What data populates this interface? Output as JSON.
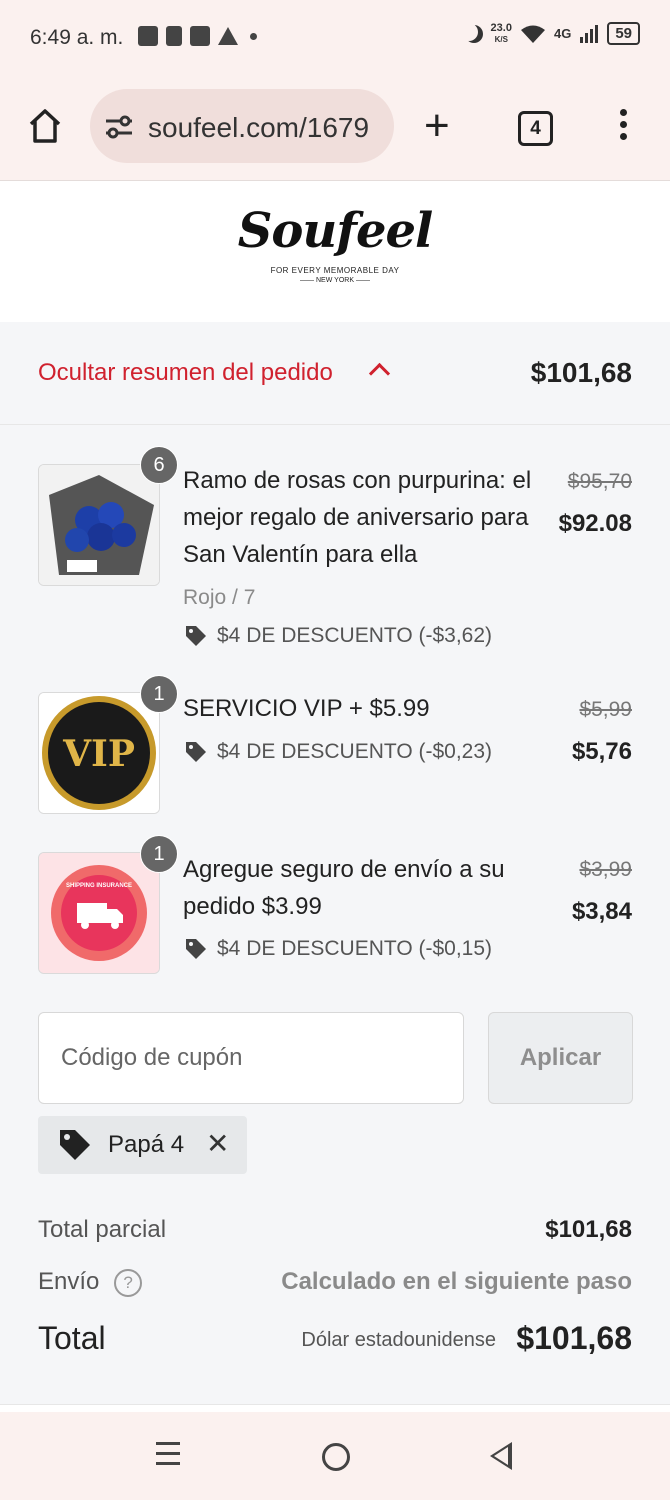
{
  "status_bar": {
    "time": "6:49 a. m.",
    "speed_value": "23.0",
    "speed_unit": "K/S",
    "network": "4G",
    "battery": "59"
  },
  "browser": {
    "url": "soufeel.com/1679",
    "tab_count": "4"
  },
  "brand": {
    "logo_text": "Soufeel",
    "tagline": "FOR EVERY MEMORABLE DAY",
    "location": "NEW YORK"
  },
  "summary": {
    "toggle_label": "Ocultar resumen del pedido",
    "total": "$101,68"
  },
  "items": [
    {
      "quantity": "6",
      "name": "Ramo de rosas con purpurina: el mejor regalo de aniversario para San Valentín para ella",
      "variant": "Rojo / 7",
      "discount": "$4 DE DESCUENTO (-$3,62)",
      "price_old": "$95,70",
      "price_new": "$92.08"
    },
    {
      "quantity": "1",
      "name": "SERVICIO VIP + $5.99",
      "discount": "$4 DE DESCUENTO (-$0,23)",
      "price_old": "$5,99",
      "price_new": "$5,76",
      "badge_text": "VIP"
    },
    {
      "quantity": "1",
      "name": "Agregue seguro de envío a su pedido $3.99",
      "discount": "$4 DE DESCUENTO (-$0,15)",
      "price_old": "$3,99",
      "price_new": "$3,84",
      "badge_text": "SHIPPING INSURANCE"
    }
  ],
  "coupon": {
    "placeholder": "Código de cupón",
    "apply_label": "Aplicar",
    "applied_code": "Papá 4"
  },
  "totals": {
    "subtotal_label": "Total parcial",
    "subtotal_value": "$101,68",
    "shipping_label": "Envío",
    "shipping_value": "Calculado en el siguiente paso",
    "help_symbol": "?",
    "total_label": "Total",
    "currency": "Dólar estadounidense",
    "total_value": "$101,68"
  },
  "colors": {
    "accent_red": "#d0212e",
    "chrome_bg": "#fbf1ef"
  }
}
